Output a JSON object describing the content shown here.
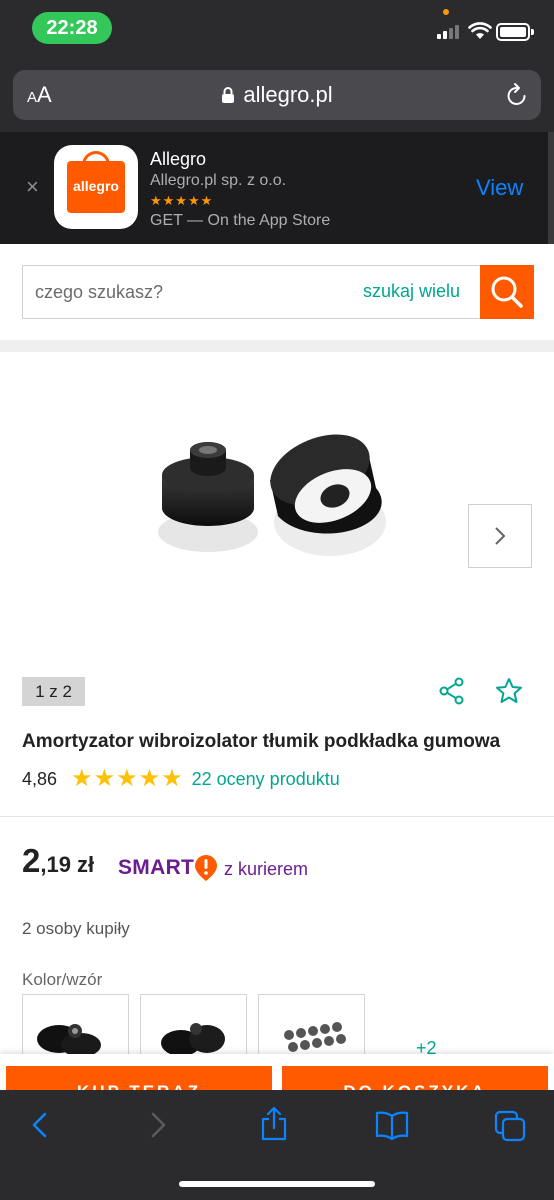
{
  "status_bar": {
    "time": "22:28"
  },
  "safari": {
    "text_size_label_small": "A",
    "text_size_label_large": "A",
    "url": "allegro.pl"
  },
  "app_banner": {
    "name": "Allegro",
    "developer": "Allegro.pl sp. z o.o.",
    "rating_stars": "★★★★★",
    "get_text": "GET — On the App Store",
    "view_label": "View",
    "icon_text": "allegro",
    "close_symbol": "×"
  },
  "search": {
    "placeholder": "czego szukasz?",
    "multi_label": "szukaj wielu"
  },
  "gallery": {
    "counter": "1 z 2"
  },
  "product": {
    "title": "Amortyzator wibroizolator tłumik podkładka gumowa",
    "rating_value": "4,86",
    "rating_stars": "★★★★★",
    "ratings_link": "22 oceny produktu"
  },
  "price": {
    "integer": "2",
    "rest": ",19 zł",
    "smart_label": "SMART",
    "delivery": "z kurierem"
  },
  "buyers": "2 osoby kupiły",
  "variants": {
    "label": "Kolor/wzór",
    "more": "+2"
  },
  "actions": {
    "buy_now": "KUP TERAZ",
    "add_to_cart": "DO KOSZYKA"
  },
  "colors": {
    "accent": "#ff5a00",
    "link": "#00a790",
    "smart": "#6b1e8f",
    "ios_blue": "#0a84ff"
  }
}
